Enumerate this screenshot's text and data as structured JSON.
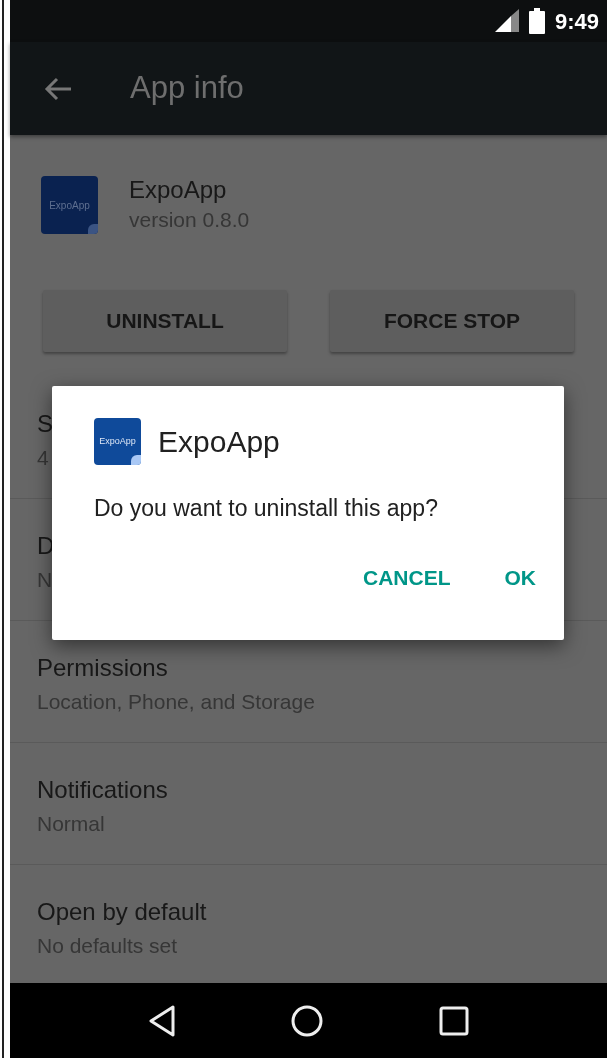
{
  "status_bar": {
    "time": "9:49"
  },
  "app_bar": {
    "title": "App info"
  },
  "app": {
    "icon_label": "ExpoApp",
    "name": "ExpoApp",
    "version": "version 0.8.0"
  },
  "buttons": [
    "UNINSTALL",
    "FORCE STOP"
  ],
  "settings": [
    {
      "title": "S",
      "subtitle": "4"
    },
    {
      "title": "D",
      "subtitle": "N"
    },
    {
      "title": "Permissions",
      "subtitle": "Location, Phone, and Storage"
    },
    {
      "title": "Notifications",
      "subtitle": "Normal"
    },
    {
      "title": "Open by default",
      "subtitle": "No defaults set"
    }
  ],
  "dialog": {
    "icon_label": "ExpoApp",
    "title": "ExpoApp",
    "message": "Do you want to uninstall this app?",
    "buttons": [
      "CANCEL",
      "OK"
    ]
  }
}
